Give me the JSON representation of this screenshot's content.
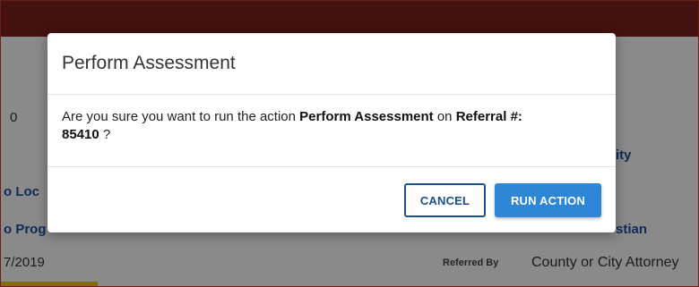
{
  "background": {
    "count_fragment": "0",
    "loc_fragment": "o Loc",
    "prog_fragment": "o Prog",
    "date_fragment": "7/2019",
    "right_fragment_1": "ity",
    "right_fragment_2": "stian",
    "referred_by_label": "Referred By",
    "referred_by_value": "County or City Attorney"
  },
  "modal": {
    "title": "Perform Assessment",
    "message_prefix": "Are you sure you want to run the action ",
    "action_name": "Perform Assessment",
    "message_middle": " on ",
    "target_label": "Referral #:",
    "referral_number": "85410",
    "message_suffix": " ?",
    "cancel_label": "CANCEL",
    "run_label": "RUN ACTION"
  },
  "colors": {
    "header": "#7b1f1a",
    "primary_button": "#2d86d6",
    "outline_button": "#1d4f8e",
    "link": "#1f4f9a"
  }
}
